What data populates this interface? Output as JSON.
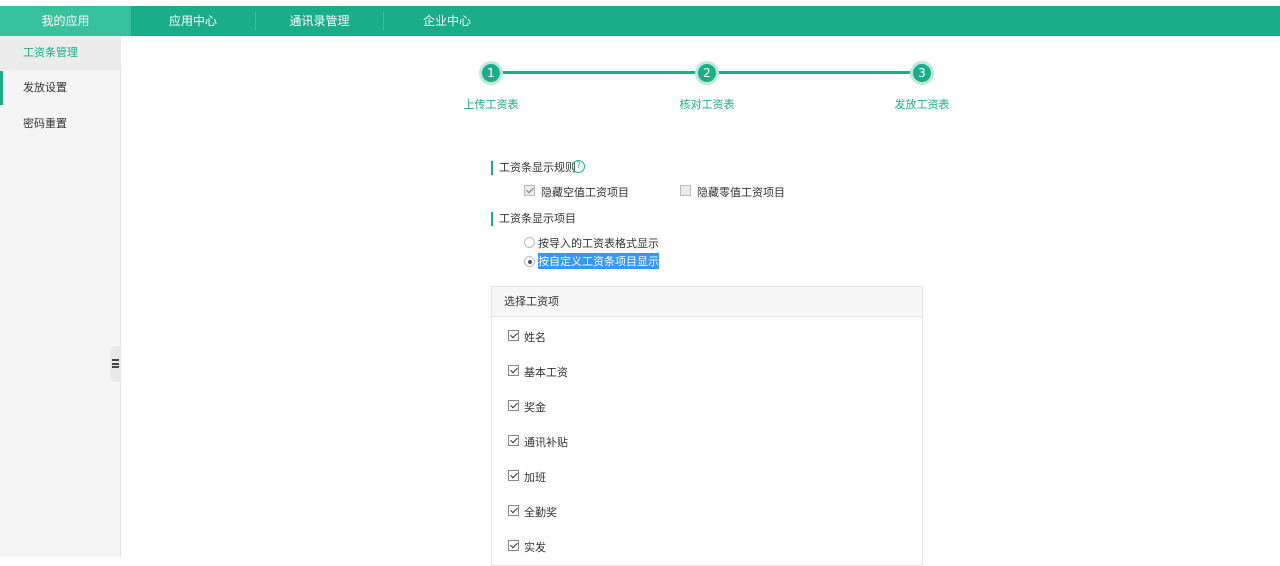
{
  "nav": {
    "items": [
      "我的应用",
      "应用中心",
      "通讯录管理",
      "企业中心"
    ],
    "active_index": 0
  },
  "sidebar": {
    "items": [
      "工资条管理",
      "发放设置",
      "密码重置"
    ],
    "active_index": 0
  },
  "steps": [
    {
      "number": "1",
      "label": "上传工资表"
    },
    {
      "number": "2",
      "label": "核对工资表"
    },
    {
      "number": "3",
      "label": "发放工资表"
    }
  ],
  "display_rules": {
    "title": "工资条显示规则",
    "help_icon": "?",
    "options": [
      {
        "label": "隐藏空值工资项目",
        "checked": true
      },
      {
        "label": "隐藏零值工资项目",
        "checked": false
      }
    ]
  },
  "display_items": {
    "title": "工资条显示项目",
    "options": [
      {
        "label": "按导入的工资表格式显示",
        "selected": false
      },
      {
        "label": "按自定义工资条项目显示",
        "selected": true
      }
    ]
  },
  "select_panel": {
    "title": "选择工资项",
    "items": [
      "姓名",
      "基本工资",
      "奖金",
      "通讯补贴",
      "加班",
      "全勤奖",
      "实发"
    ]
  },
  "colors": {
    "brand": "#1aae88",
    "brand_active": "#36c29c",
    "selection": "#3399ff"
  }
}
